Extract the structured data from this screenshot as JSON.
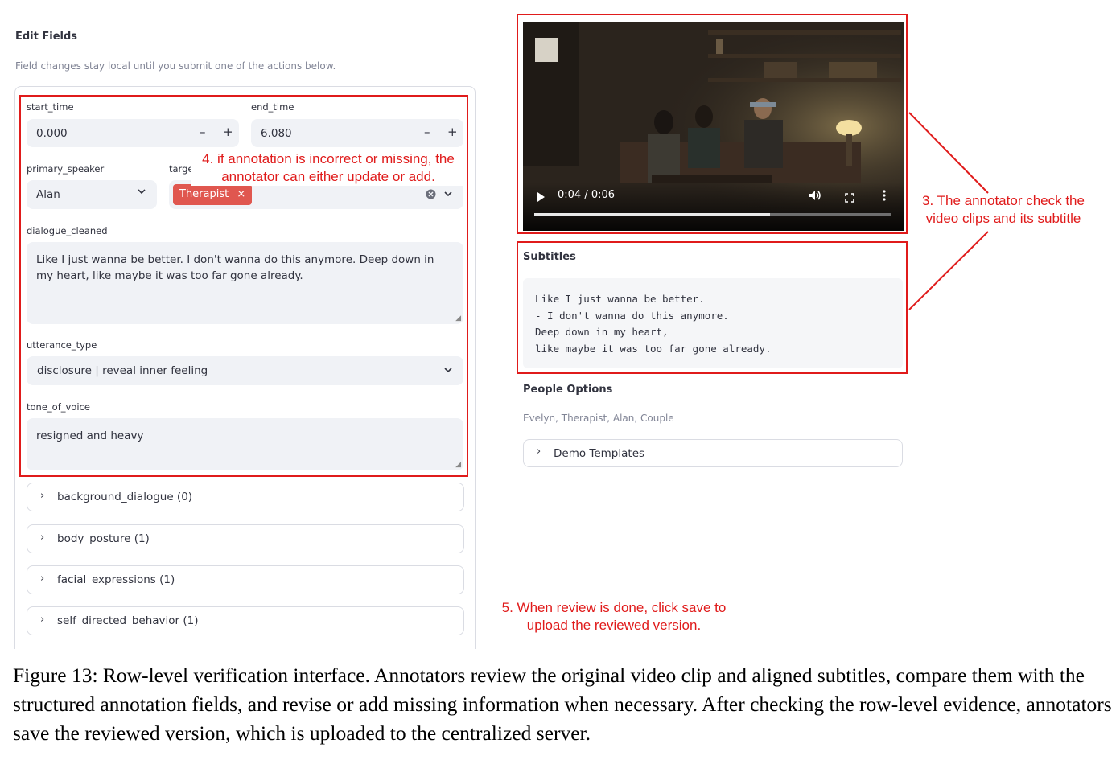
{
  "edit_panel": {
    "title": "Edit Fields",
    "note": "Field changes stay local until you submit one of the actions below.",
    "start_time": {
      "label": "start_time",
      "value": "0.000",
      "minus": "–",
      "plus": "+"
    },
    "end_time": {
      "label": "end_time",
      "value": "6.080",
      "minus": "–",
      "plus": "+"
    },
    "primary_speaker": {
      "label": "primary_speaker",
      "value": "Alan"
    },
    "target": {
      "label": "target",
      "tag": "Therapist",
      "tag_remove": "×"
    },
    "dialogue_cleaned": {
      "label": "dialogue_cleaned",
      "value": "Like I just wanna be better. I don't wanna do this anymore. Deep down in my heart, like maybe it was too far gone already."
    },
    "utterance_type": {
      "label": "utterance_type",
      "value": "disclosure | reveal inner feeling"
    },
    "tone_of_voice": {
      "label": "tone_of_voice",
      "value": "resigned and heavy"
    },
    "expanders": [
      {
        "label": "background_dialogue (0)"
      },
      {
        "label": "body_posture (1)"
      },
      {
        "label": "facial_expressions (1)"
      },
      {
        "label": "self_directed_behavior (1)"
      }
    ]
  },
  "video": {
    "time": "0:04 / 0:06",
    "progress": 0.66
  },
  "subtitles": {
    "title": "Subtitles",
    "lines": [
      "Like I just wanna be better.",
      "- I don't wanna do this anymore.",
      "Deep down in my heart,",
      "like maybe it was too far gone already."
    ]
  },
  "people": {
    "title": "People Options",
    "list": "Evelyn, Therapist, Alan, Couple",
    "demo_templates": "Demo Templates"
  },
  "annotations": {
    "step4_line1": "4. if annotation is incorrect or missing, the",
    "step4_line2": "annotator can either update or add.",
    "step3_line1": "3. The annotator check the",
    "step3_line2": "video clips and its subtitle",
    "step5_line1": "5. When review is done, click save to",
    "step5_line2": "upload the reviewed version."
  },
  "caption": "Figure 13: Row-level verification interface. Annotators review the original video clip and aligned subtitles, compare them with the structured annotation fields, and revise or add missing information when necessary. After checking the row-level evidence, annotators save the reviewed version, which is uploaded to the centralized server.",
  "colors": {
    "annotation_red": "#e01b1b",
    "tag_red": "#e0574f",
    "input_bg": "#f0f2f6"
  }
}
